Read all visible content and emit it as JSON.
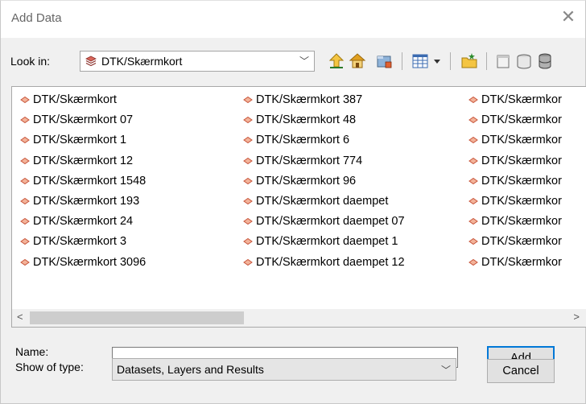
{
  "window": {
    "title": "Add Data",
    "close_glyph": "✕"
  },
  "lookin": {
    "label": "Look in:",
    "value": "DTK/Skærmkort",
    "icon": "raster-layer-icon"
  },
  "toolbar": {
    "buttons": [
      "up-one-level-icon",
      "home-icon",
      "connect-folder-icon",
      "view-list-icon",
      "view-dropdown-icon",
      "new-folder-icon",
      "new-file-icon",
      "new-geodatabase-icon",
      "new-server-icon"
    ]
  },
  "list": {
    "columns": [
      [
        "DTK/Skærmkort",
        "DTK/Skærmkort 07",
        "DTK/Skærmkort 1",
        "DTK/Skærmkort 12",
        "DTK/Skærmkort 1548",
        "DTK/Skærmkort 193",
        "DTK/Skærmkort 24",
        "DTK/Skærmkort 3",
        "DTK/Skærmkort 3096"
      ],
      [
        "DTK/Skærmkort 387",
        "DTK/Skærmkort 48",
        "DTK/Skærmkort 6",
        "DTK/Skærmkort 774",
        "DTK/Skærmkort 96",
        "DTK/Skærmkort daempet",
        "DTK/Skærmkort daempet 07",
        "DTK/Skærmkort daempet 1",
        "DTK/Skærmkort daempet 12"
      ],
      [
        "DTK/Skærmkor",
        "DTK/Skærmkor",
        "DTK/Skærmkor",
        "DTK/Skærmkor",
        "DTK/Skærmkor",
        "DTK/Skærmkor",
        "DTK/Skærmkor",
        "DTK/Skærmkor",
        "DTK/Skærmkor"
      ]
    ],
    "item_icon": "wms-layer-icon",
    "scroll_left": "<",
    "scroll_right": ">"
  },
  "name_field": {
    "label": "Name:",
    "value": ""
  },
  "type_field": {
    "label": "Show of type:",
    "value": "Datasets, Layers and Results"
  },
  "buttons": {
    "add": "Add",
    "cancel": "Cancel"
  },
  "colors": {
    "accent": "#0078d7",
    "item_icon": "#e07a5f"
  }
}
